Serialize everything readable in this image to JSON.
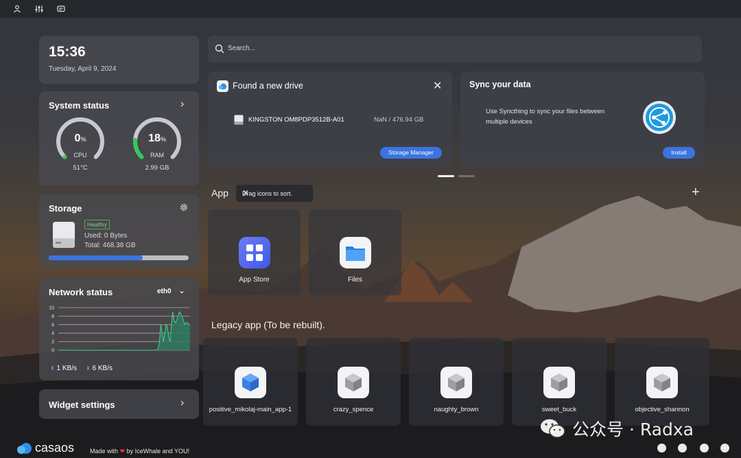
{
  "clock": {
    "time": "15:36",
    "date": "Tuesday, April 9, 2024"
  },
  "system_status": {
    "title": "System status",
    "cpu": {
      "value": "0",
      "unit": "%",
      "label": "CPU",
      "sub": "51°C",
      "percent": 0
    },
    "ram": {
      "value": "18",
      "unit": "%",
      "label": "RAM",
      "sub": "2.99 GB",
      "percent": 18
    }
  },
  "storage": {
    "title": "Storage",
    "badge": "Healthy",
    "used": "Used: 0 Bytes",
    "total": "Total: 468.38 GB",
    "fill_fraction": 0.67
  },
  "network": {
    "title": "Network status",
    "interface": "eth0",
    "upload": "1 KB/s",
    "download": "6 KB/s",
    "up_arrow": "⬆",
    "down_arrow": "⬇",
    "chart_data": {
      "type": "area",
      "yticks": [
        "10",
        "8",
        "6",
        "4",
        "2",
        "0"
      ],
      "ylim": [
        0,
        10
      ],
      "values": [
        0,
        0,
        0,
        0,
        0,
        0,
        0,
        0,
        0,
        0,
        0,
        0,
        0,
        0,
        0,
        0,
        0,
        0,
        0,
        0,
        0,
        0,
        0,
        0,
        0,
        0,
        0,
        0,
        0,
        0,
        0,
        0,
        0,
        0,
        0,
        0,
        0,
        0,
        0,
        0,
        0,
        0,
        0,
        0,
        0,
        0,
        0,
        0,
        0,
        0,
        0,
        0,
        0,
        0,
        0,
        0,
        0,
        0,
        0,
        0,
        0,
        0,
        0,
        0,
        0,
        0,
        0,
        0,
        0,
        0,
        0,
        0,
        0,
        0,
        0,
        0.5,
        2,
        6,
        4,
        2,
        4,
        6,
        5.5,
        3,
        2,
        6,
        9,
        7,
        6.5,
        7,
        8,
        9,
        8.5,
        8,
        7,
        6,
        6.5,
        6.5,
        6,
        6
      ]
    }
  },
  "widget_settings": {
    "label": "Widget settings"
  },
  "search": {
    "placeholder": "Search..."
  },
  "drive_card": {
    "title": "Found a new drive",
    "drive_name": "KINGSTON OM8PDP3512B-A01",
    "drive_size": "NaN / 476.94 GB",
    "button": "Storage Manager"
  },
  "sync_card": {
    "title": "Sync your data",
    "description": "Use Syncthing to sync your files between multiple devices",
    "button": "Install"
  },
  "apps": {
    "title": "App",
    "tooltip": "Drag icons to sort.",
    "add_symbol": "+",
    "items": [
      {
        "name": "App Store"
      },
      {
        "name": "Files"
      }
    ]
  },
  "legacy": {
    "title": "Legacy app (To be rebuilt).",
    "items": [
      {
        "name": "positive_mikolaj-main_app-1",
        "color": "#3b7fe6"
      },
      {
        "name": "crazy_spence",
        "color": "#9b9ea3"
      },
      {
        "name": "naughty_brown",
        "color": "#9b9ea3"
      },
      {
        "name": "sweet_buck",
        "color": "#9b9ea3"
      },
      {
        "name": "objective_shannon",
        "color": "#9b9ea3"
      }
    ]
  },
  "footer": {
    "logo": "casaos",
    "made_with": "Made with",
    "heart": "❤",
    "by": "by IceWhale and YOU!"
  },
  "watermark": {
    "text": "公众号 · Radxa"
  },
  "colors": {
    "accent": "#3b74e0",
    "healthy": "#7fd18a",
    "gauge_green": "#34c759",
    "network_fill": "#2f7a62"
  }
}
